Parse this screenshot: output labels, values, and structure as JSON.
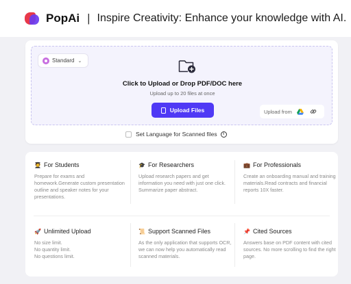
{
  "header": {
    "brand": "PopAi",
    "divider": "|",
    "tagline": "Inspire Creativity: Enhance your knowledge with AI.",
    "logo_colors": [
      "#e8394a",
      "#6a3cf0"
    ]
  },
  "upload": {
    "model_label": "Standard",
    "title": "Click to Upload or Drop PDF/DOC here",
    "subtitle": "Upload up to 20 files at once",
    "button_label": "Upload Files",
    "upload_from_label": "Upload from",
    "accent": "#4f39f5",
    "icons": [
      "chevron-down-icon",
      "folder-add-icon",
      "file-icon",
      "google-drive-icon",
      "link-icon"
    ]
  },
  "language": {
    "label": "Set Language for Scanned files",
    "checked": false
  },
  "features": [
    {
      "icon": "🧑‍🎓",
      "title": "For Students",
      "desc": "Prepare for exams and homework.Generate custom presentation outline and speaker notes for your presentations."
    },
    {
      "icon": "🎓",
      "title": "For Researchers",
      "desc": "Upload research papers and get information you need with just one click. Summarize paper abstract."
    },
    {
      "icon": "💼",
      "title": "For Professionals",
      "desc": "Create an onboarding manual and training materials.Read contracts and financial reports 10X faster."
    },
    {
      "icon": "🚀",
      "title": "Unlimited Upload",
      "desc": "No size limit.\nNo quantity limit.\nNo questions limit."
    },
    {
      "icon": "📜",
      "title": "Support Scanned Files",
      "desc": "As the only application that supports OCR, we can now help you automatically read scanned materials."
    },
    {
      "icon": "📌",
      "title": "Cited Sources",
      "desc": "Answers base on PDF content with cited sources. No more scrolling to find the right page."
    }
  ]
}
